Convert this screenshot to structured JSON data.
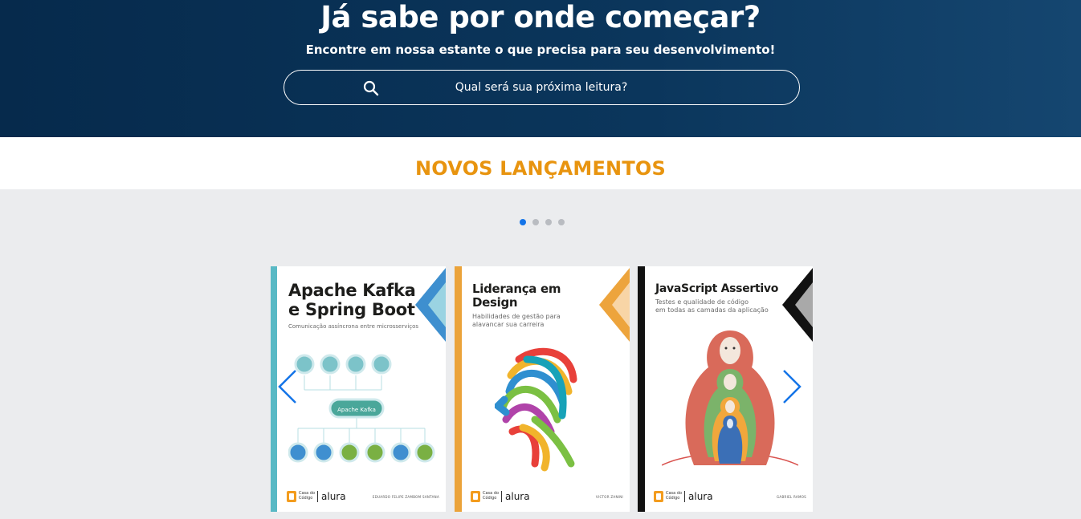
{
  "hero": {
    "title": "Já sabe por onde começar?",
    "subtitle": "Encontre em nossa estante o que precisa para seu desenvolvimento!",
    "search_placeholder": "Qual será sua próxima leitura?",
    "background": "#0b365c"
  },
  "section": {
    "title": "NOVOS LANÇAMENTOS",
    "title_color": "#e8940f"
  },
  "carousel": {
    "page_count": 4,
    "active_page": 1,
    "accent_color": "#1474e8",
    "prev_icon": "chevron-left-icon",
    "next_icon": "chevron-right-icon"
  },
  "books": [
    {
      "title_line1": "Apache Kafka",
      "title_line2": "e Spring Boot",
      "subtitle": "Comunicação assíncrona entre microsserviços",
      "center_label": "Apache Kafka",
      "author": "EDUARDO FELIPE ZAMBOM SANTANA",
      "publisher": "Casa do Código",
      "brand": "alura",
      "accent": "#4ba9d4"
    },
    {
      "title_line1": "Liderança em",
      "title_line2": "Design",
      "subtitle_line1": "Habilidades de gestão para",
      "subtitle_line2": "alavancar sua carreira",
      "author": "VICTOR ZANINI",
      "publisher": "Casa do Código",
      "brand": "alura",
      "accent": "#eda43c"
    },
    {
      "title_line1": "JavaScript Assertivo",
      "subtitle_line1": "Testes e qualidade de código",
      "subtitle_line2": "em todas as camadas da aplicação",
      "author": "GABRIEL RAMOS",
      "publisher": "Casa do Código",
      "brand": "alura",
      "accent": "#111111"
    }
  ]
}
